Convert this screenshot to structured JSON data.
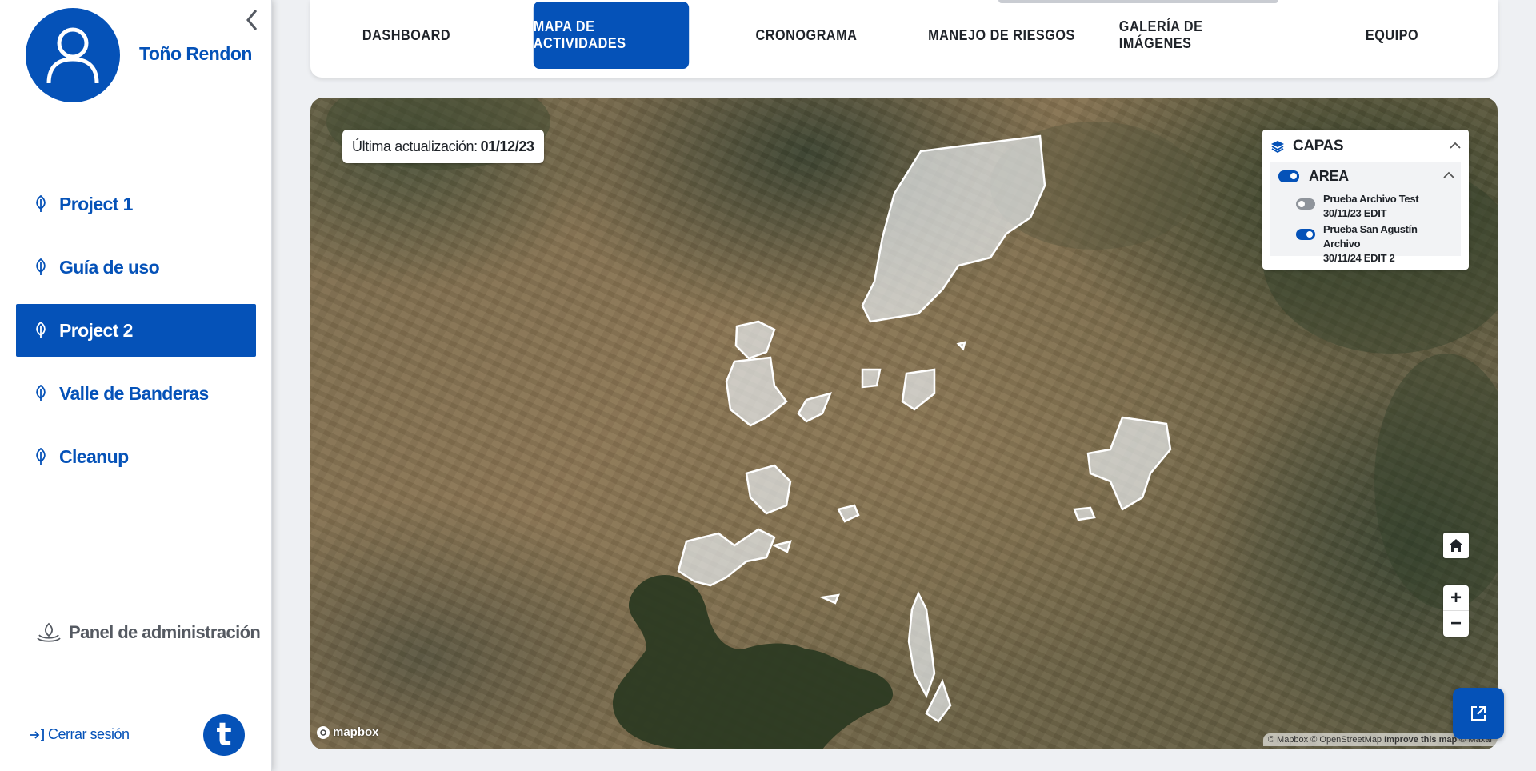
{
  "user": {
    "name": "Toño Rendon",
    "avatar_icon": "user-icon"
  },
  "sidebar": {
    "collapse_icon": "chevron-left-icon",
    "items": [
      {
        "label": "Project 1",
        "icon": "leaf-icon",
        "active": false
      },
      {
        "label": "Guía de uso",
        "icon": "leaf-icon",
        "active": false
      },
      {
        "label": "Project 2",
        "icon": "leaf-icon",
        "active": true
      },
      {
        "label": "Valle de Banderas",
        "icon": "leaf-icon",
        "active": false
      },
      {
        "label": "Cleanup",
        "icon": "leaf-icon",
        "active": false
      }
    ],
    "admin_label": "Panel de administración",
    "logout_label": "Cerrar sesión",
    "brand_letter": "t"
  },
  "tabs": [
    {
      "label": "DASHBOARD",
      "active": false
    },
    {
      "label": "MAPA DE ACTIVIDADES",
      "active": true
    },
    {
      "label": "CRONOGRAMA",
      "active": false
    },
    {
      "label": "MANEJO DE RIESGOS",
      "active": false
    },
    {
      "label": "GALERÍA DE IMÁGENES",
      "active": false
    },
    {
      "label": "EQUIPO",
      "active": false
    }
  ],
  "map": {
    "update_label": "Última actualización:",
    "update_date": "01/12/23",
    "layers": {
      "title": "CAPAS",
      "group": "AREA",
      "group_enabled": true,
      "items": [
        {
          "line1": "Prueba Archivo Test",
          "line2": "30/11/23 EDIT",
          "enabled": false
        },
        {
          "line1": "Prueba San Agustín Archivo",
          "line2": "30/11/24 EDIT 2",
          "enabled": true
        }
      ]
    },
    "controls": {
      "home_icon": "home-icon",
      "zoom_in": "+",
      "zoom_out": "−"
    },
    "logo_text": "mapbox",
    "attribution": {
      "mapbox": "© Mapbox",
      "osm": "© OpenStreetMap",
      "improve": "Improve this map",
      "maxar": "© Maxar"
    },
    "external_icon": "external-link-icon"
  },
  "colors": {
    "brand": "#0552b8",
    "polygon_fill": "#e8ecef",
    "polygon_stroke": "#ffffff"
  }
}
